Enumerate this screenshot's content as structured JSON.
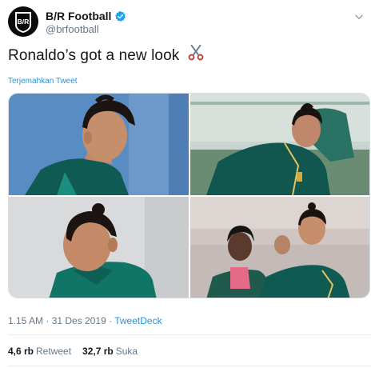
{
  "author": {
    "display_name": "B/R Football",
    "handle": "@brfootball",
    "avatar_text": "B/R",
    "verified_icon": "verified-badge-icon"
  },
  "tweet": {
    "text": "Ronaldo’s got a new look",
    "emoji_icon": "scissors-icon",
    "translate_label": "Terjemahkan Tweet"
  },
  "media": {
    "photos": [
      {
        "icon": "photo-ronaldo-side-profile",
        "jersey_color": "#0f5a52",
        "background": "#5a8cc4"
      },
      {
        "icon": "photo-ronaldo-training",
        "jersey_color": "#11574f",
        "background": "#c8d4cf"
      },
      {
        "icon": "photo-ronaldo-man-bun",
        "jersey_color": "#107466",
        "background": "#d9dadb"
      },
      {
        "icon": "photo-ronaldo-smiling",
        "jersey_color": "#0f5a52",
        "background": "#cfc6c3"
      }
    ]
  },
  "meta": {
    "time": "1.15 AM",
    "separator": " · ",
    "date": "31 Des 2019",
    "source": "TweetDeck"
  },
  "stats": {
    "retweets_count": "4,6 rb",
    "retweets_label": "Retweet",
    "likes_count": "32,7 rb",
    "likes_label": "Suka"
  },
  "colors": {
    "link": "#1b95e0",
    "secondary_text": "#657786",
    "verified": "#1da1f2"
  }
}
